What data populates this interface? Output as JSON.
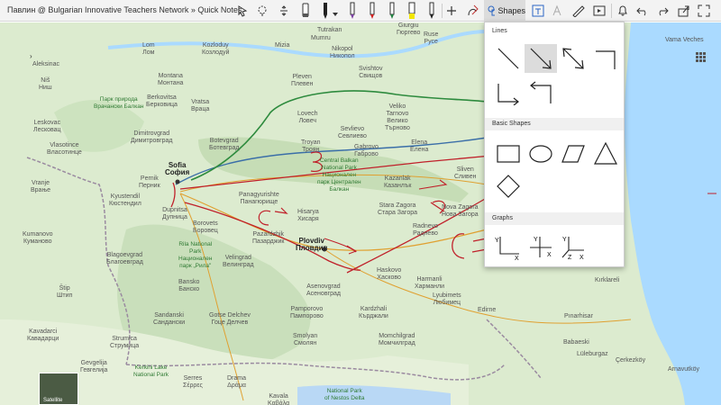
{
  "window": {
    "title": "Павлин @ Bulgarian Innovative Teachers Network » Quick Notes"
  },
  "toolbar": {
    "shapes_label": "Shapes"
  },
  "shapes_panel": {
    "sections": [
      {
        "title": "Lines"
      },
      {
        "title": "Basic Shapes"
      },
      {
        "title": "Graphs"
      }
    ],
    "graph_axis_labels": {
      "y1": "Y",
      "x1": "X",
      "y2": "Y",
      "x2": "X",
      "y3": "Y",
      "z3": "Z",
      "x3": "X"
    }
  },
  "map": {
    "labels": [
      {
        "id": "girgiu",
        "text": "Giurgiu\nГюргево",
        "cls": ""
      },
      {
        "id": "ruse",
        "text": "Ruse\nРусе",
        "cls": ""
      },
      {
        "id": "tutrakan",
        "text": "Tutrakan",
        "cls": ""
      },
      {
        "id": "mumru",
        "text": "Mumru",
        "cls": ""
      },
      {
        "id": "vama",
        "text": "Vama Veches",
        "cls": ""
      },
      {
        "id": "lom",
        "text": "Lom\nЛом",
        "cls": ""
      },
      {
        "id": "kozlodui",
        "text": "Kozloduy\nКозлодуй",
        "cls": ""
      },
      {
        "id": "mizia",
        "text": "Mizia",
        "cls": ""
      },
      {
        "id": "nikopol",
        "text": "Nikopol\nНикопол",
        "cls": ""
      },
      {
        "id": "aleksinac",
        "text": "Aleksinac",
        "cls": ""
      },
      {
        "id": "svishtov",
        "text": "Svishtov\nСвищов",
        "cls": ""
      },
      {
        "id": "nis",
        "text": "Niš\nНиш",
        "cls": ""
      },
      {
        "id": "montana",
        "text": "Montana\nМонтана",
        "cls": ""
      },
      {
        "id": "pleven",
        "text": "Pleven\nПлевен",
        "cls": ""
      },
      {
        "id": "park1",
        "text": "Парк природа\nВрачански Балкан",
        "cls": "park"
      },
      {
        "id": "berkovitsa",
        "text": "Berkovitsa\nБерковица",
        "cls": ""
      },
      {
        "id": "vratsa",
        "text": "Vratsa\nВраца",
        "cls": ""
      },
      {
        "id": "lovech",
        "text": "Lovech\nЛовеч",
        "cls": ""
      },
      {
        "id": "veliko",
        "text": "Veliko\nTarnovo\nВелико\nТърново",
        "cls": ""
      },
      {
        "id": "leskovac",
        "text": "Leskovac\nЛесковац",
        "cls": ""
      },
      {
        "id": "vlasotince",
        "text": "Vlasotince\nВласотинце",
        "cls": ""
      },
      {
        "id": "dimitrovgrad",
        "text": "Dimitrovgrad\nДимитровград",
        "cls": ""
      },
      {
        "id": "botevgrad",
        "text": "Botevgrad\nБотевград",
        "cls": ""
      },
      {
        "id": "troyan",
        "text": "Troyan\nТроян",
        "cls": ""
      },
      {
        "id": "sevlievo",
        "text": "Sevlievo\nСевлиево",
        "cls": ""
      },
      {
        "id": "gabrovo",
        "text": "Gabrovo\nГаброво",
        "cls": ""
      },
      {
        "id": "elena",
        "text": "Elena\nЕлена",
        "cls": ""
      },
      {
        "id": "sofia",
        "text": "Sofia\nСофия",
        "cls": "big"
      },
      {
        "id": "pernik",
        "text": "Pernik\nПерник",
        "cls": ""
      },
      {
        "id": "vranje",
        "text": "Vranje\nВрање",
        "cls": ""
      },
      {
        "id": "central",
        "text": "Central Balkan\nNational Park\nНационален\nпарк Централен\nБалкан",
        "cls": "park"
      },
      {
        "id": "kazanlak",
        "text": "Kazanlak\nКазанлък",
        "cls": ""
      },
      {
        "id": "sliven",
        "text": "Sliven\nСливен",
        "cls": ""
      },
      {
        "id": "panag",
        "text": "Panagyurishte\nПанагюрище",
        "cls": ""
      },
      {
        "id": "hisarya",
        "text": "Hisarya\nХисаря",
        "cls": ""
      },
      {
        "id": "starazagora",
        "text": "Stara Zagora\nСтара Загора",
        "cls": ""
      },
      {
        "id": "nova",
        "text": "Nova Zagora\nНова Загора",
        "cls": ""
      },
      {
        "id": "radnevo",
        "text": "Radnevo\nРаднево",
        "cls": ""
      },
      {
        "id": "kyustendil",
        "text": "Kyustendil\nКюстендил",
        "cls": ""
      },
      {
        "id": "dupnitsa",
        "text": "Dupnitsa\nДупница",
        "cls": ""
      },
      {
        "id": "borovets",
        "text": "Borovets\nБоровец",
        "cls": ""
      },
      {
        "id": "pazardzhik",
        "text": "Pazardzhik\nПазарджик",
        "cls": ""
      },
      {
        "id": "plovdiv",
        "text": "Plovdiv\nПловдив",
        "cls": "big"
      },
      {
        "id": "kumanovo",
        "text": "Kumanovo\nКуманово",
        "cls": ""
      },
      {
        "id": "rila",
        "text": "Rila National\nPark\nНационален\nпарк „Рила\"",
        "cls": "park"
      },
      {
        "id": "velingrad",
        "text": "Velingrad\nВелинград",
        "cls": ""
      },
      {
        "id": "blagoevgrad",
        "text": "Blagoevgrad\nБлагоевград",
        "cls": ""
      },
      {
        "id": "haskovo",
        "text": "Haskovo\nХасково",
        "cls": ""
      },
      {
        "id": "harmanli",
        "text": "Harmanli\nХарманли",
        "cls": ""
      },
      {
        "id": "asenovgrad",
        "text": "Asenovgrad\nАсеновград",
        "cls": ""
      },
      {
        "id": "bansko",
        "text": "Bansko\nБанско",
        "cls": ""
      },
      {
        "id": "stip",
        "text": "Štip\nШтип",
        "cls": ""
      },
      {
        "id": "sandanski",
        "text": "Sandanski\nСандански",
        "cls": ""
      },
      {
        "id": "gotse",
        "text": "Gotse Delchev\nГоце Делчев",
        "cls": ""
      },
      {
        "id": "pamporovo",
        "text": "Pamporovo\nПампорово",
        "cls": ""
      },
      {
        "id": "kardzhali",
        "text": "Kardzhali\nКърджали",
        "cls": ""
      },
      {
        "id": "lyubimets",
        "text": "Lyubimets\nЛюбимец",
        "cls": ""
      },
      {
        "id": "edirne",
        "text": "Edirne",
        "cls": ""
      },
      {
        "id": "kavadarci",
        "text": "Kavadarci\nКавадарци",
        "cls": ""
      },
      {
        "id": "strumica",
        "text": "Strumica\nСтрумица",
        "cls": ""
      },
      {
        "id": "smolyan",
        "text": "Smolyan\nСмолян",
        "cls": ""
      },
      {
        "id": "momchilgrad",
        "text": "Momchilgrad\nМомчилград",
        "cls": ""
      },
      {
        "id": "pinarhisar",
        "text": "Pınarhisar",
        "cls": ""
      },
      {
        "id": "babaeski",
        "text": "Babaeski",
        "cls": ""
      },
      {
        "id": "luleburgaz",
        "text": "Lüleburgaz",
        "cls": ""
      },
      {
        "id": "gevgelija",
        "text": "Gevgelija\nГевгелија",
        "cls": ""
      },
      {
        "id": "kerkini",
        "text": "Kerkini Lake\nNational Park",
        "cls": "park"
      },
      {
        "id": "serres",
        "text": "Serres\nΣέρρες",
        "cls": ""
      },
      {
        "id": "drama",
        "text": "Drama\nΔράμα",
        "cls": ""
      },
      {
        "id": "kavala",
        "text": "Kavala\nΚαβάλα",
        "cls": ""
      },
      {
        "id": "nestos",
        "text": "National Park\nof Nestos Delta",
        "cls": "park"
      },
      {
        "id": "kirklareli",
        "text": "Kırklareli",
        "cls": ""
      },
      {
        "id": "cerkezkoy",
        "text": "Çerkezköy",
        "cls": ""
      },
      {
        "id": "arnavutkoy",
        "text": "Arnavutköy",
        "cls": ""
      }
    ],
    "annotations": {
      "arrow_a": "a",
      "letter_b": "b",
      "letter_c1": "c",
      "letter_c2": "c"
    },
    "thumbnail_label": "Satellite"
  },
  "colors": {
    "map_bg": "#dcebcf",
    "water": "#aadaff",
    "ink_red": "#c0202a",
    "road_green": "#2e8b3e",
    "road_blue": "#3a6ea8"
  }
}
